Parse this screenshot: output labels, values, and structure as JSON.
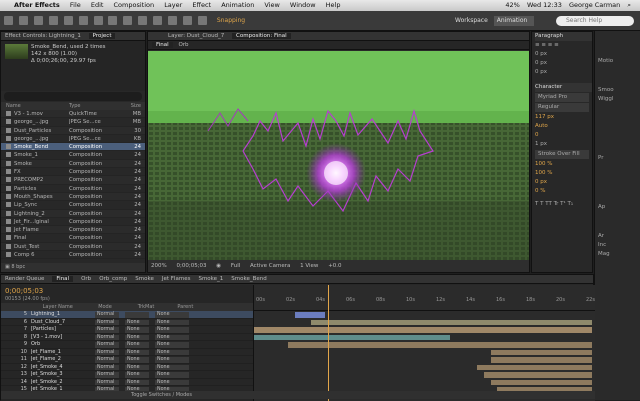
{
  "menubar": {
    "app": "After Effects",
    "items": [
      "File",
      "Edit",
      "Composition",
      "Layer",
      "Effect",
      "Animation",
      "View",
      "Window",
      "Help"
    ],
    "clock": "Wed 12:33",
    "user": "George Carman",
    "battery": "42%"
  },
  "toolbar": {
    "workspace_label": "Workspace",
    "workspace_value": "Animation",
    "search_placeholder": "Search Help",
    "snapping": "Snapping"
  },
  "project": {
    "tab_project": "Project",
    "tab_effects": "Effect Controls: Lightning_1",
    "item_name": "Smoke_Bend",
    "item_usage": ", used 2 times",
    "item_dims": "142 x 800 (1.00)",
    "item_duration": "Δ 0;00;26;00, 29.97 fps",
    "columns": {
      "name": "Name",
      "type": "Type",
      "size": "Size"
    },
    "items": [
      {
        "name": "V3 - 1.mov",
        "type": "QuickTime",
        "size": "MB"
      },
      {
        "name": "george_...jpg",
        "type": "JPEG Se...ce",
        "size": "MB"
      },
      {
        "name": "Dust_Particles",
        "type": "Composition",
        "size": "30"
      },
      {
        "name": "george_...jpg",
        "type": "JPEG Se...ce",
        "size": "KB"
      },
      {
        "name": "Smoke_Bend",
        "type": "Composition",
        "size": "24"
      },
      {
        "name": "Smoke_1",
        "type": "Composition",
        "size": "24"
      },
      {
        "name": "Smoke",
        "type": "Composition",
        "size": "24"
      },
      {
        "name": "FX",
        "type": "Composition",
        "size": "24"
      },
      {
        "name": "PRECOMP2",
        "type": "Composition",
        "size": "24"
      },
      {
        "name": "Particles",
        "type": "Composition",
        "size": "24"
      },
      {
        "name": "Mouth_Shapes",
        "type": "Composition",
        "size": "24"
      },
      {
        "name": "Lip_Sync",
        "type": "Composition",
        "size": "24"
      },
      {
        "name": "Lightning_2",
        "type": "Composition",
        "size": "24"
      },
      {
        "name": "Jet_Fir...lginal",
        "type": "Composition",
        "size": "24"
      },
      {
        "name": "Jet Flame",
        "type": "Composition",
        "size": "24"
      },
      {
        "name": "Final",
        "type": "Composition",
        "size": "24"
      },
      {
        "name": "Dust_Test",
        "type": "Composition",
        "size": "24"
      },
      {
        "name": "Comp 6",
        "type": "Composition",
        "size": "24"
      }
    ],
    "footer": "8 bpc"
  },
  "comp": {
    "tab_layer": "Layer: Dust_Cloud_7",
    "tab_comp": "Composition: Final",
    "crumb_final": "Final",
    "crumb_orb": "Orb",
    "zoom": "200%",
    "time": "0;00;05;03",
    "resolution": "Full",
    "camera": "Active Camera",
    "view": "1 View",
    "exposure": "+0.0"
  },
  "paragraph": {
    "title": "Paragraph",
    "v1": "0 px",
    "v2": "0 px",
    "v3": "0 px"
  },
  "character": {
    "title": "Character",
    "font": "Myriad Pro",
    "style": "Regular",
    "size": "117 px",
    "leading": "Auto",
    "tracking": "0",
    "stroke": "1 px",
    "stroke_mode": "Stroke Over Fill",
    "vscale": "100 %",
    "hscale": "100 %",
    "baseline": "0 px",
    "tsume": "0 %"
  },
  "farright": {
    "items": [
      "Motio",
      "Smoo",
      "Wiggl",
      "Pr",
      "Ap",
      "Ar",
      "Inc",
      "Mag"
    ]
  },
  "timeline": {
    "tabs": [
      "Render Queue",
      "Final",
      "Orb",
      "Orb_comp",
      "Smoke",
      "Jet Flames",
      "Smoke_1",
      "Smoke_Bend"
    ],
    "timecode": "0;00;05;03",
    "frame_info": "00153 (24.00 fps)",
    "columns": {
      "name": "Layer Name",
      "mode": "Mode",
      "trkmat": "TrkMat",
      "parent": "Parent"
    },
    "ruler_labels": [
      "00s",
      "02s",
      "04s",
      "06s",
      "08s",
      "10s",
      "12s",
      "14s",
      "16s",
      "18s",
      "20s",
      "22s"
    ],
    "layers": [
      {
        "num": "5",
        "name": "Lightning_1",
        "mode": "Normal",
        "trkmat": "",
        "parent": "None",
        "bar_start": 0.12,
        "bar_end": 0.21,
        "color": "#6b7dbf"
      },
      {
        "num": "6",
        "name": "Dust_Cloud_7",
        "mode": "Normal",
        "trkmat": "None",
        "parent": "None",
        "bar_start": 0.17,
        "bar_end": 1.0,
        "color": "#8f8a6c"
      },
      {
        "num": "7",
        "name": "[Particles]",
        "mode": "Normal",
        "trkmat": "None",
        "parent": "None",
        "bar_start": 0.0,
        "bar_end": 1.0,
        "color": "#a08868"
      },
      {
        "num": "8",
        "name": "[V3 - 1.mov]",
        "mode": "Normal",
        "trkmat": "None",
        "parent": "None",
        "bar_start": 0.0,
        "bar_end": 0.58,
        "color": "#5f8d8c"
      },
      {
        "num": "9",
        "name": "Orb",
        "mode": "Normal",
        "trkmat": "None",
        "parent": "None",
        "bar_start": 0.1,
        "bar_end": 1.0,
        "color": "#8e7a5e"
      },
      {
        "num": "10",
        "name": "Jet_Flame_1",
        "mode": "Normal",
        "trkmat": "None",
        "parent": "None",
        "bar_start": 0.7,
        "bar_end": 1.0,
        "color": "#8e7a5e"
      },
      {
        "num": "11",
        "name": "Jet_Flame_2",
        "mode": "Normal",
        "trkmat": "None",
        "parent": "None",
        "bar_start": 0.7,
        "bar_end": 1.0,
        "color": "#8e7a5e"
      },
      {
        "num": "12",
        "name": "Jet_Smoke_4",
        "mode": "Normal",
        "trkmat": "None",
        "parent": "None",
        "bar_start": 0.66,
        "bar_end": 1.0,
        "color": "#8e7a5e"
      },
      {
        "num": "13",
        "name": "Jet_Smoke_3",
        "mode": "Normal",
        "trkmat": "None",
        "parent": "None",
        "bar_start": 0.68,
        "bar_end": 1.0,
        "color": "#8e7a5e"
      },
      {
        "num": "14",
        "name": "Jet_Smoke_2",
        "mode": "Normal",
        "trkmat": "None",
        "parent": "None",
        "bar_start": 0.7,
        "bar_end": 1.0,
        "color": "#8e7a5e"
      },
      {
        "num": "15",
        "name": "Jet_Smoke_1",
        "mode": "Normal",
        "trkmat": "None",
        "parent": "None",
        "bar_start": 0.72,
        "bar_end": 1.0,
        "color": "#8e7a5e"
      }
    ],
    "footer": "Toggle Switches / Modes",
    "current_time_fraction": 0.215
  }
}
